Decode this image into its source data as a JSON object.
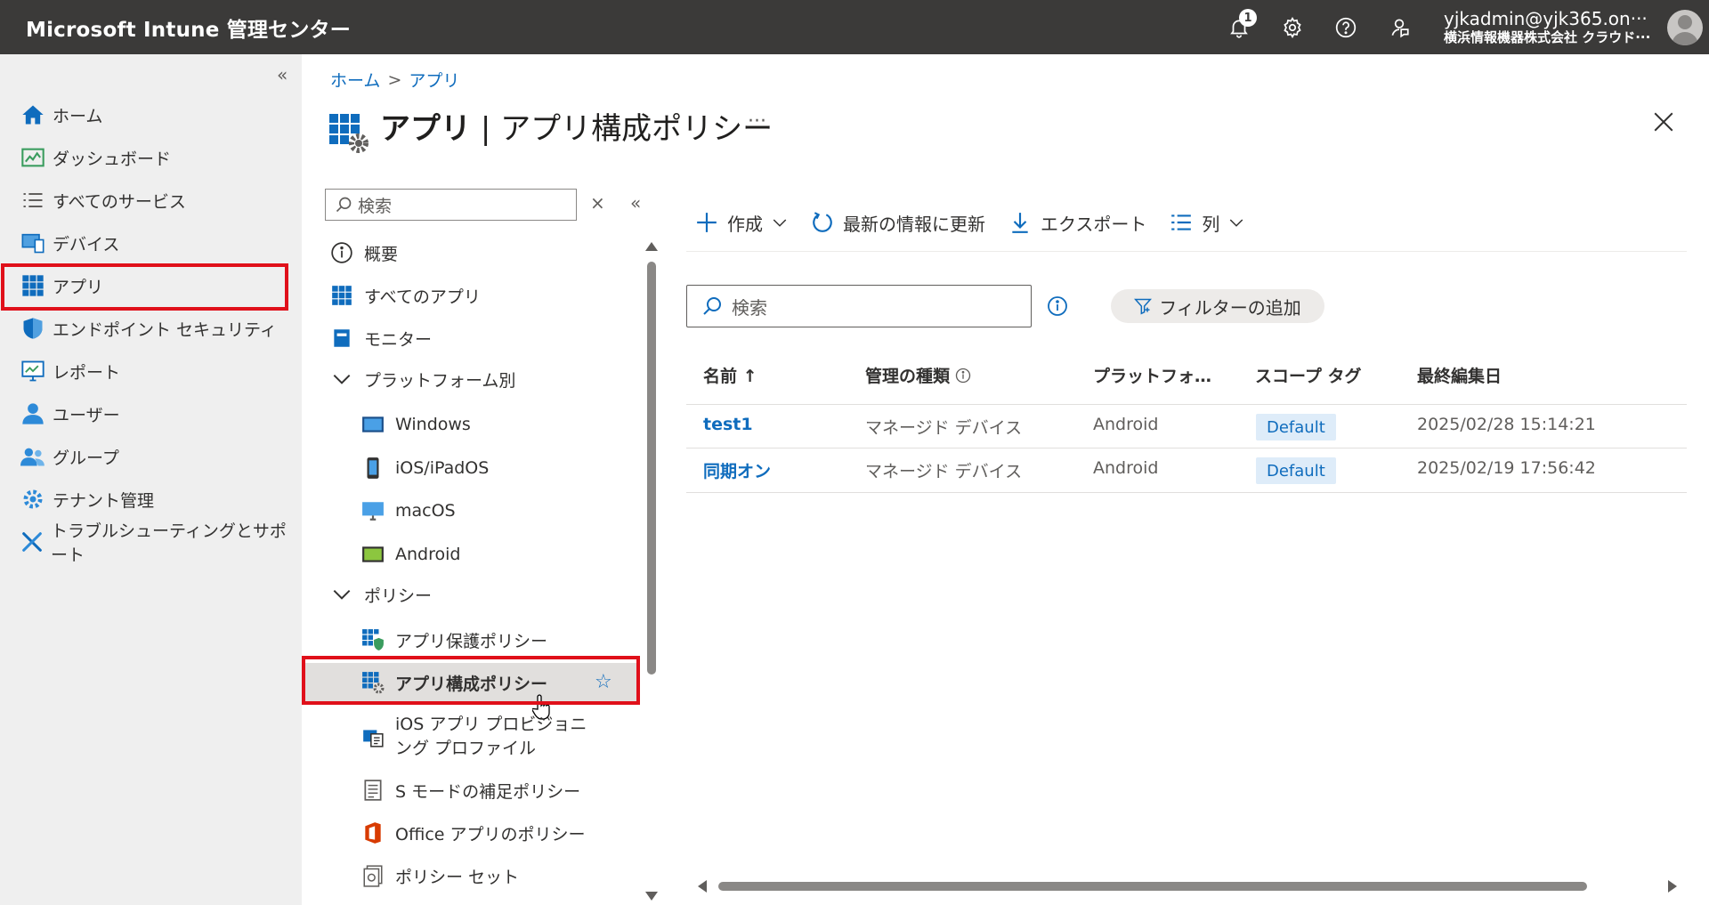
{
  "header": {
    "brand": "Microsoft Intune 管理センター",
    "notification_count": "1",
    "account_email": "yjkadmin@yjk365.on···",
    "account_tenant": "横浜情報機器株式会社 クラウド···"
  },
  "leftnav": {
    "collapse": "«",
    "items": [
      {
        "label": "ホーム",
        "icon": "home-icon"
      },
      {
        "label": "ダッシュボード",
        "icon": "dashboard-icon"
      },
      {
        "label": "すべてのサービス",
        "icon": "list-icon"
      },
      {
        "label": "デバイス",
        "icon": "devices-icon"
      },
      {
        "label": "アプリ",
        "icon": "apps-grid-icon"
      },
      {
        "label": "エンドポイント セキュリティ",
        "icon": "shield-icon"
      },
      {
        "label": "レポート",
        "icon": "report-icon"
      },
      {
        "label": "ユーザー",
        "icon": "user-icon"
      },
      {
        "label": "グループ",
        "icon": "group-icon"
      },
      {
        "label": "テナント管理",
        "icon": "tenant-gear-icon"
      },
      {
        "label": "トラブルシューティングとサポート",
        "icon": "wrench-icon"
      }
    ],
    "selected_index": 4
  },
  "breadcrumb": {
    "home": "ホーム",
    "sep": ">",
    "current": "アプリ"
  },
  "page": {
    "title_bold": "アプリ",
    "title_sep": "|",
    "title_rest": "アプリ構成ポリシー",
    "more": "···"
  },
  "resource_menu": {
    "search_placeholder": "検索",
    "clear": "×",
    "collapse": "«",
    "items": {
      "overview": "概要",
      "all_apps": "すべてのアプリ",
      "monitor": "モニター",
      "by_platform": "プラットフォーム別",
      "windows": "Windows",
      "ios": "iOS/iPadOS",
      "macos": "macOS",
      "android": "Android",
      "policy": "ポリシー",
      "app_protection": "アプリ保護ポリシー",
      "app_config": "アプリ構成ポリシー",
      "ios_provisioning": "iOS アプリ プロビジョニング プロファイル",
      "s_mode": "S モードの補足ポリシー",
      "office": "Office アプリのポリシー",
      "policy_set": "ポリシー セット"
    },
    "favorite": "☆"
  },
  "toolbar": {
    "create": "作成",
    "refresh": "最新の情報に更新",
    "export": "エクスポート",
    "columns": "列"
  },
  "content": {
    "search_placeholder": "検索",
    "filter": "フィルターの追加"
  },
  "table": {
    "columns": [
      "名前 ↑",
      "管理の種類",
      "プラットフォ…",
      "スコープ タグ",
      "最終編集日"
    ],
    "rows": [
      {
        "name": "test1",
        "type": "マネージド デバイス",
        "platform": "Android",
        "scope": "Default",
        "modified": "2025/02/28 15:14:21"
      },
      {
        "name": "同期オン",
        "type": "マネージド デバイス",
        "platform": "Android",
        "scope": "Default",
        "modified": "2025/02/19 17:56:42"
      }
    ]
  },
  "colors": {
    "topbar": "#3b3a39",
    "accent": "#0f6cbd",
    "highlight": "#e0101a",
    "nav_bg": "#efefef"
  }
}
